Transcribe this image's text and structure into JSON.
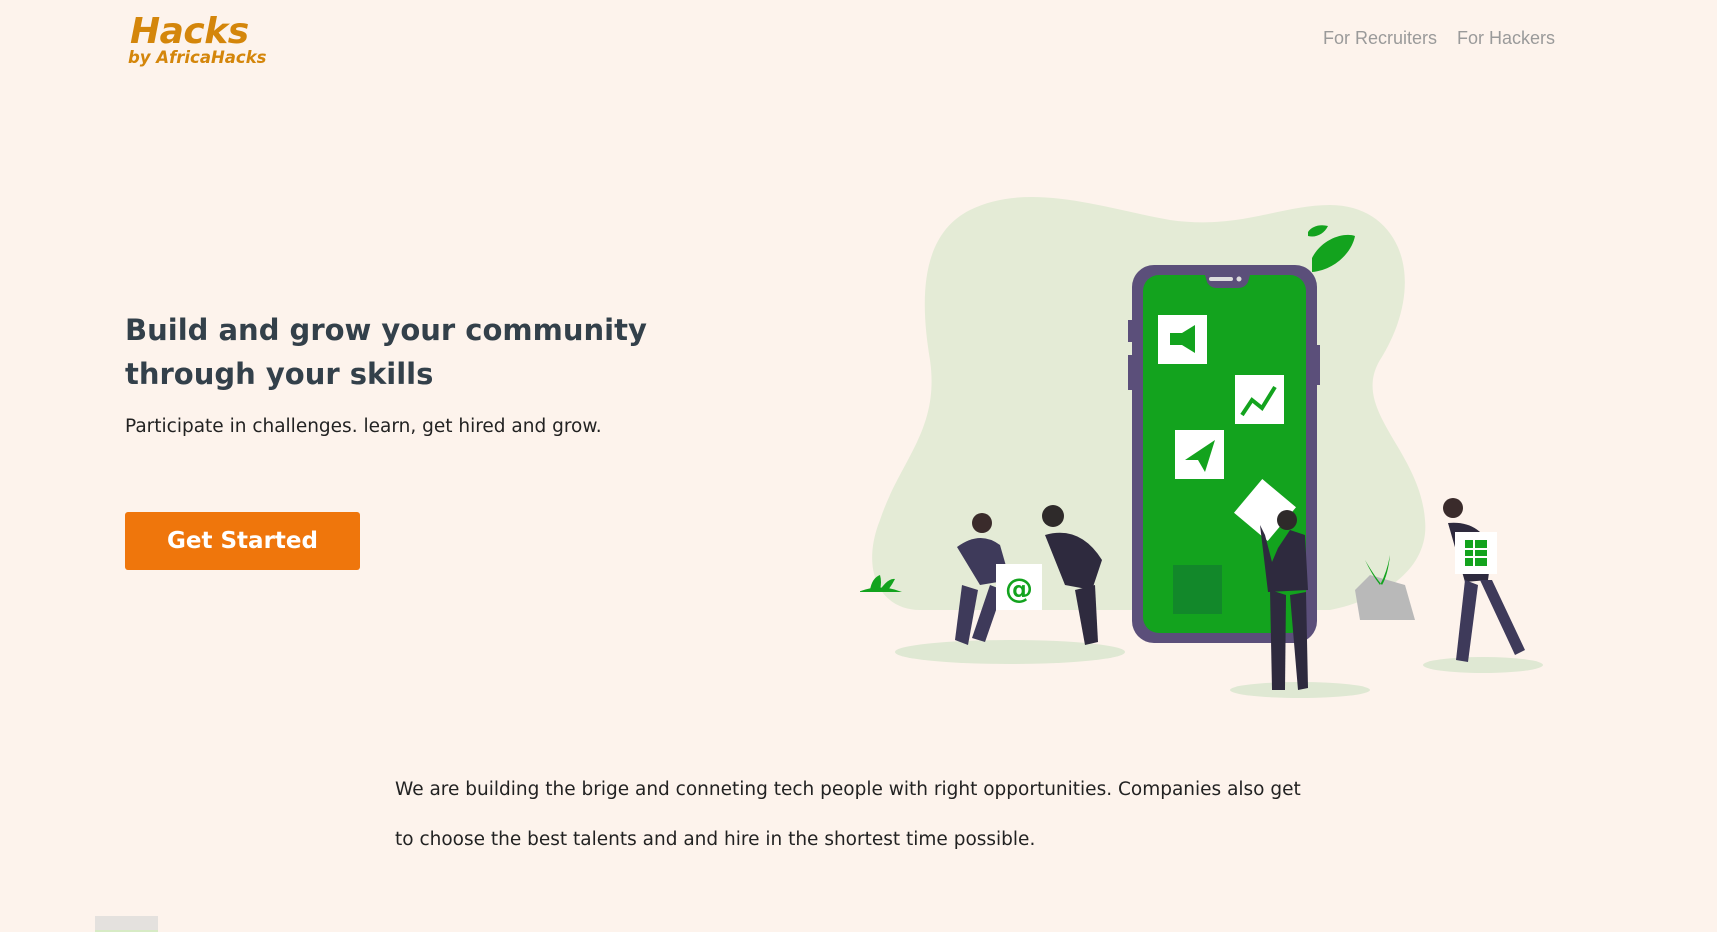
{
  "header": {
    "logo_main": "Hacks",
    "logo_sub": "by AfricaHacks",
    "nav": [
      {
        "label": "For Recruiters"
      },
      {
        "label": "For Hackers"
      }
    ]
  },
  "hero": {
    "title": "Build and grow your community through your skills",
    "subtitle": "Participate in challenges. learn, get hired and grow.",
    "cta_label": "Get Started"
  },
  "about": {
    "text": "We are building the brige and conneting tech people with right opportunities. Companies also get to choose the best talents and and hire in the shortest time possible."
  },
  "colors": {
    "background": "#fdf3ec",
    "brand": "#d4860b",
    "accent": "#ef760c",
    "illustration_green": "#13a31e",
    "heading": "#33404a"
  }
}
